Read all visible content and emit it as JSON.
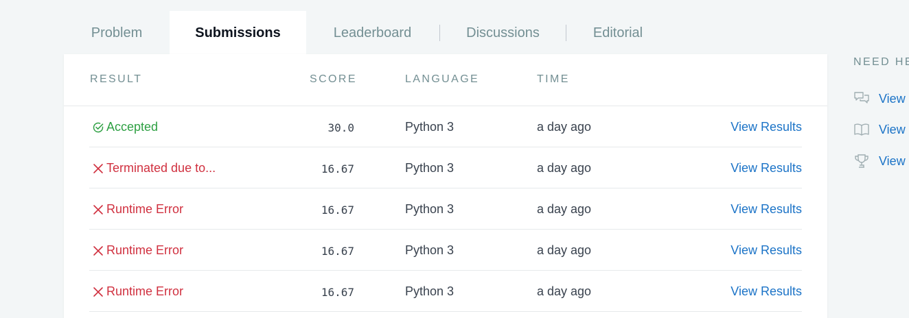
{
  "tabs": [
    {
      "label": "Problem",
      "active": false
    },
    {
      "label": "Submissions",
      "active": true
    },
    {
      "label": "Leaderboard",
      "active": false
    },
    {
      "label": "Discussions",
      "active": false
    },
    {
      "label": "Editorial",
      "active": false
    }
  ],
  "table": {
    "columns": {
      "result": "RESULT",
      "score": "SCORE",
      "language": "LANGUAGE",
      "time": "TIME"
    },
    "rows": [
      {
        "result": "Accepted",
        "status": "accepted",
        "score": "30.0",
        "language": "Python 3",
        "time": "a day ago",
        "action": "View Results"
      },
      {
        "result": "Terminated due to...",
        "status": "error",
        "score": "16.67",
        "language": "Python 3",
        "time": "a day ago",
        "action": "View Results"
      },
      {
        "result": "Runtime Error",
        "status": "error",
        "score": "16.67",
        "language": "Python 3",
        "time": "a day ago",
        "action": "View Results"
      },
      {
        "result": "Runtime Error",
        "status": "error",
        "score": "16.67",
        "language": "Python 3",
        "time": "a day ago",
        "action": "View Results"
      },
      {
        "result": "Runtime Error",
        "status": "error",
        "score": "16.67",
        "language": "Python 3",
        "time": "a day ago",
        "action": "View Results"
      }
    ]
  },
  "help": {
    "title": "NEED HE",
    "items": [
      {
        "label": "View",
        "icon": "chat-bubbles-icon"
      },
      {
        "label": "View",
        "icon": "open-book-icon"
      },
      {
        "label": "View",
        "icon": "trophy-icon"
      }
    ]
  },
  "colors": {
    "accepted": "#2ea043",
    "error": "#d0303f",
    "link": "#1b73c7",
    "muted": "#738f93",
    "background": "#f3f6f7"
  }
}
